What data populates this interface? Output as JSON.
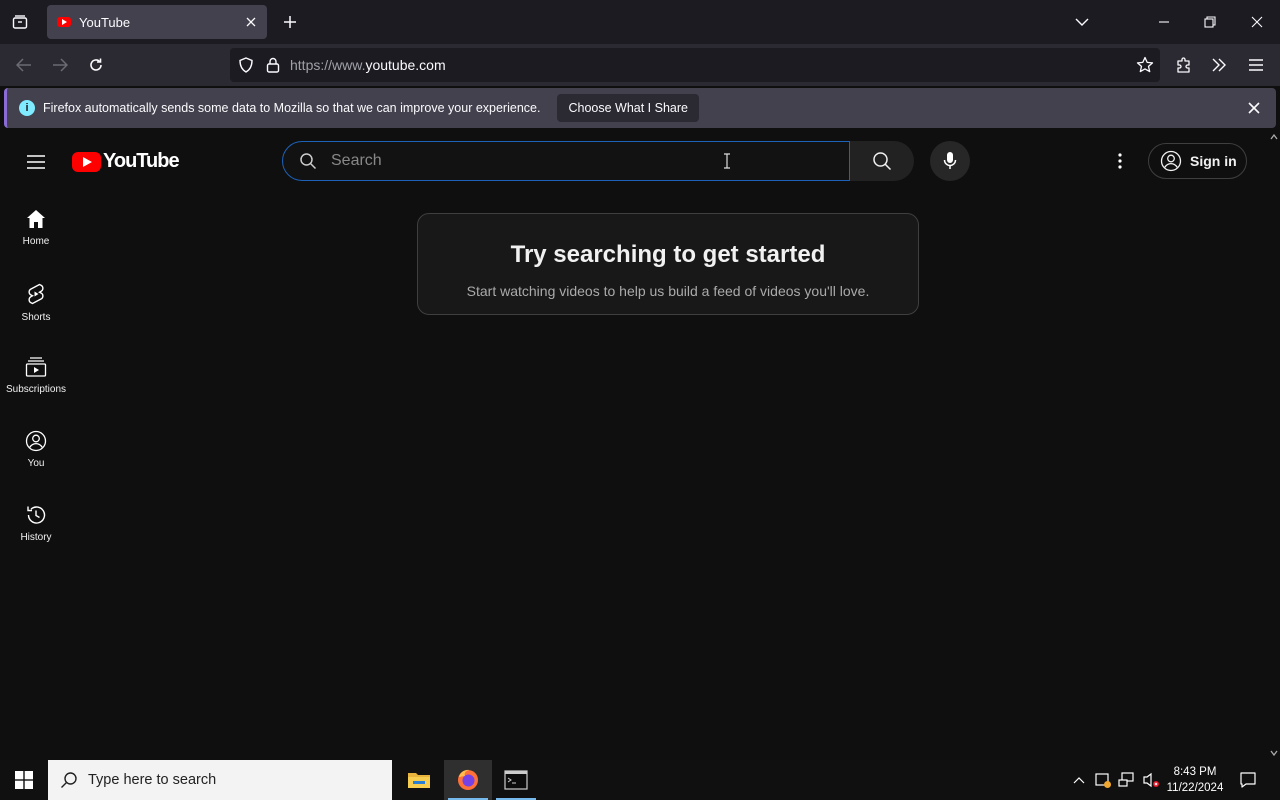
{
  "browser": {
    "tab": {
      "title": "YouTube"
    },
    "url": {
      "prefix": "https://www.",
      "domain": "youtube.com"
    },
    "notification": {
      "message": "Firefox automatically sends some data to Mozilla so that we can improve your experience.",
      "button_label": "Choose What I Share"
    }
  },
  "youtube": {
    "logo_text": "YouTube",
    "search": {
      "placeholder": "Search"
    },
    "sign_in_label": "Sign in",
    "guide": [
      {
        "label": "Home",
        "icon": "home-icon"
      },
      {
        "label": "Shorts",
        "icon": "shorts-icon"
      },
      {
        "label": "Subscriptions",
        "icon": "subscriptions-icon"
      },
      {
        "label": "You",
        "icon": "you-icon"
      },
      {
        "label": "History",
        "icon": "history-icon"
      }
    ],
    "empty_state": {
      "title": "Try searching to get started",
      "subtitle": "Start watching videos to help us build a feed of videos you'll love."
    }
  },
  "taskbar": {
    "search_placeholder": "Type here to search",
    "time": "8:43 PM",
    "date": "11/22/2024"
  },
  "colors": {
    "yt_background": "#0f0f0f",
    "yt_red": "#ff0000",
    "search_focus": "#1c62b9",
    "firefox_toolbar": "#2b2a33"
  }
}
